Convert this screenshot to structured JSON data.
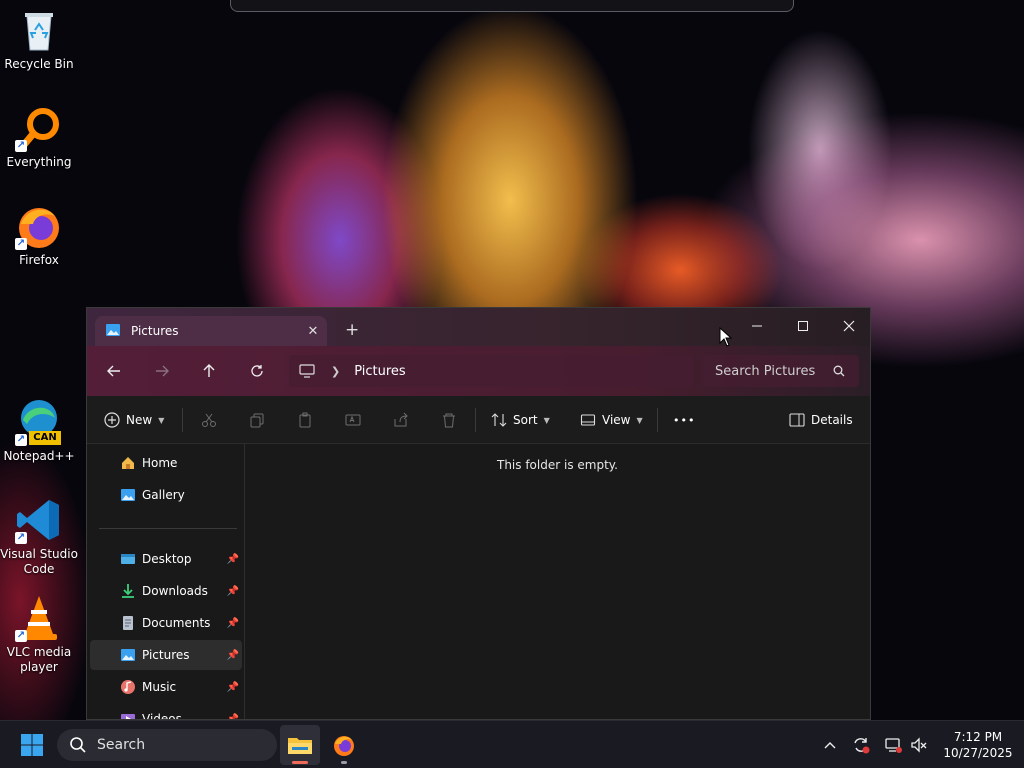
{
  "desktop": {
    "icons": [
      {
        "label": "Recycle Bin",
        "icon": "recycle-bin-icon"
      },
      {
        "label": "Everything",
        "icon": "everything-search-icon"
      },
      {
        "label": "Firefox",
        "icon": "firefox-icon"
      },
      {
        "label": "Notepad++",
        "icon": "notepad-plus-plus-icon",
        "badge": "CAN"
      },
      {
        "label": "Visual Studio Code",
        "icon": "vscode-icon"
      },
      {
        "label": "VLC media player",
        "icon": "vlc-icon"
      }
    ]
  },
  "explorer": {
    "tab_title": "Pictures",
    "tab_close": "✕",
    "new_tab": "+",
    "address": {
      "crumb": "Pictures"
    },
    "search_placeholder": "Search Pictures",
    "toolbar": {
      "new_label": "New",
      "sort_label": "Sort",
      "view_label": "View",
      "more_label": "•••",
      "details_label": "Details"
    },
    "sidebar": {
      "top_items": [
        {
          "label": "Home",
          "icon": "home-icon"
        },
        {
          "label": "Gallery",
          "icon": "gallery-icon"
        }
      ],
      "pinned_items": [
        {
          "label": "Desktop",
          "icon": "desktop-folder-icon"
        },
        {
          "label": "Downloads",
          "icon": "downloads-folder-icon"
        },
        {
          "label": "Documents",
          "icon": "documents-folder-icon"
        },
        {
          "label": "Pictures",
          "icon": "pictures-folder-icon",
          "selected": true
        },
        {
          "label": "Music",
          "icon": "music-folder-icon"
        },
        {
          "label": "Videos",
          "icon": "videos-folder-icon"
        }
      ]
    },
    "empty_message": "This folder is empty."
  },
  "taskbar": {
    "search_placeholder": "Search",
    "clock": {
      "time": "7:12 PM",
      "date": "10/27/2025"
    },
    "accent": "#0078d4"
  }
}
